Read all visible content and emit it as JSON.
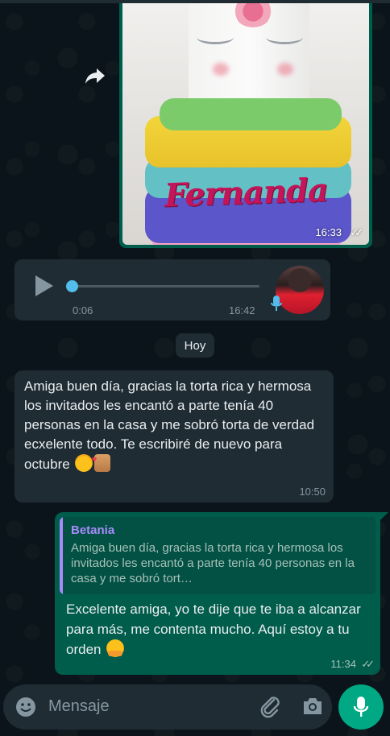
{
  "image_message": {
    "topper_text": "Fernanda",
    "time": "16:33",
    "ticks": "✓✓"
  },
  "audio_message": {
    "elapsed": "0:06",
    "time": "16:42"
  },
  "date_divider": "Hoy",
  "incoming_message": {
    "text": "Amiga buen día, gracias la torta rica y hermosa los invitados les encantó a parte tenía 40 personas en la casa y me sobró torta de verdad ecxelente todo. Te escribiré de nuevo para octubre",
    "time": "10:50",
    "emojis": [
      "smiling-face-with-hearts",
      "thumbs-up"
    ]
  },
  "outgoing_message": {
    "quoted_author": "Betania",
    "quoted_text": "Amiga buen día, gracias la torta rica y hermosa los invitados les encantó a parte tenía 40 personas en la casa y me sobró tort…",
    "text": "Excelente amiga, yo te dije que te iba a alcanzar para más, me contenta mucho. Aquí estoy a tu orden",
    "time": "11:34",
    "ticks": "✓✓",
    "emoji": "hugging-face"
  },
  "composer": {
    "placeholder": "Mensaje"
  },
  "icons": {
    "forward": "forward-icon",
    "play": "play-icon",
    "mic": "mic-icon",
    "emoji": "emoji-icon",
    "attach": "paperclip-icon",
    "camera": "camera-icon"
  },
  "colors": {
    "background": "#0b141a",
    "incoming_bubble": "#1f2c34",
    "outgoing_bubble": "#005c4b",
    "accent": "#00a884",
    "quote_author": "#a78bfa",
    "audio_progress": "#53bdeb"
  }
}
